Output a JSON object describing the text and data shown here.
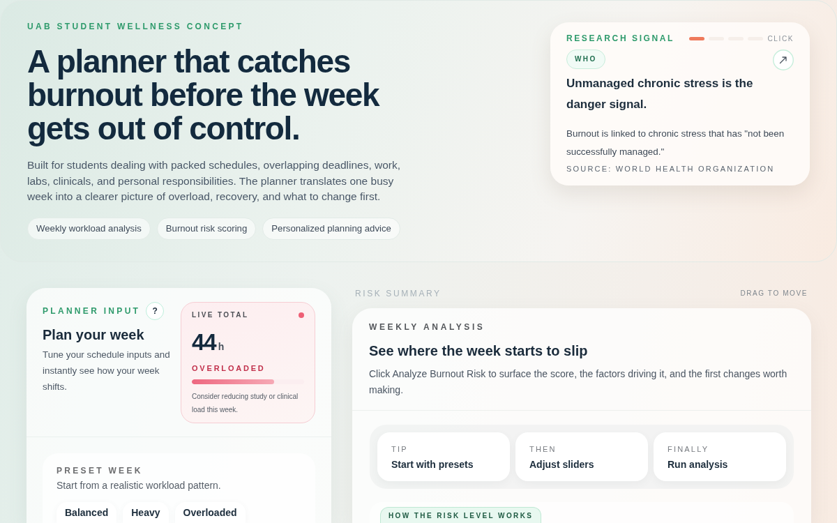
{
  "hero": {
    "eyebrow": "UAB STUDENT WELLNESS CONCEPT",
    "headline": "A planner that catches burnout before the week gets out of control.",
    "description": "Built for students dealing with packed schedules, overlapping deadlines, work, labs, clinicals, and personal responsibilities. The planner translates one busy week into a clearer picture of overload, recovery, and what to change first.",
    "tags": [
      "Weekly workload analysis",
      "Burnout risk scoring",
      "Personalized planning advice"
    ]
  },
  "research_card": {
    "label": "RESEARCH SIGNAL",
    "slides": [
      {
        "selected": true
      },
      {
        "selected": false
      },
      {
        "selected": false
      },
      {
        "selected": false
      }
    ],
    "hint": "CLICK",
    "badge": "WHO",
    "headline": "Unmanaged chronic stress is the danger signal.",
    "body": "Burnout is linked to chronic stress that has \"not been successfully managed.\"",
    "source": "SOURCE: WORLD HEALTH ORGANIZATION"
  },
  "planner": {
    "label": "PLANNER INPUT",
    "help": "?",
    "title": "Plan your week",
    "description": "Tune your schedule inputs and instantly see how your week shifts.",
    "live_total": {
      "label": "LIVE TOTAL",
      "value": "44",
      "unit": "h",
      "status": "OVERLOADED",
      "level": 0.73,
      "note": "Consider reducing study or clinical load this week."
    },
    "preset": {
      "label": "PRESET WEEK",
      "description": "Start from a realistic workload pattern.",
      "options": [
        "Balanced",
        "Heavy",
        "Overloaded"
      ]
    }
  },
  "risk_summary": {
    "label": "RISK SUMMARY",
    "hint": "DRAG TO MOVE",
    "eyebrow": "WEEKLY ANALYSIS",
    "title": "See where the week starts to slip",
    "description": "Click Analyze Burnout Risk to surface the score, the factors driving it, and the first changes worth making.",
    "steps": [
      {
        "label": "TIP",
        "text": "Start with presets"
      },
      {
        "label": "THEN",
        "text": "Adjust sliders"
      },
      {
        "label": "FINALLY",
        "text": "Run analysis"
      }
    ],
    "explainer_badge": "HOW THE RISK LEVEL WORKS"
  }
}
